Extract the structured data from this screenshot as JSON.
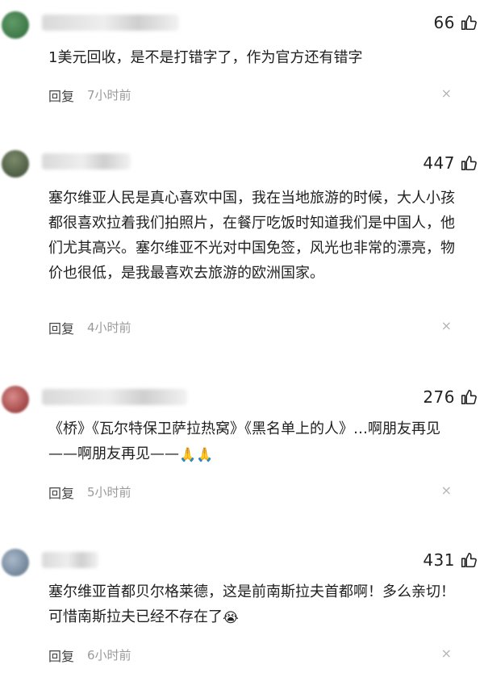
{
  "comments": [
    {
      "likes": "66",
      "text": "1美元回收，是不是打错字了，作为官方还有错字",
      "reply_label": "回复",
      "time": "7小时前",
      "close_glyph": "×",
      "avatar_color": "#3f7f4a"
    },
    {
      "likes": "447",
      "text": "塞尔维亚人民是真心喜欢中国，我在当地旅游的时候，大人小孩都很喜欢拉着我们拍照片，在餐厅吃饭时知道我们是中国人，他们尤其高兴。塞尔维亚不光对中国免签，风光也非常的漂亮，物价也很低，是我最喜欢去旅游的欧洲国家。",
      "reply_label": "回复",
      "time": "4小时前",
      "close_glyph": "×",
      "avatar_color": "#4f5a45"
    },
    {
      "likes": "276",
      "text": "《桥》《瓦尔特保卫萨拉热窝》《黑名单上的人》…啊朋友再见——啊朋友再见——",
      "emoji": "🙏🙏",
      "reply_label": "回复",
      "time": "5小时前",
      "close_glyph": "×",
      "avatar_color": "#b04a4a"
    },
    {
      "likes": "431",
      "text": "塞尔维亚首都贝尔格莱德，这是前南斯拉夫首都啊！多么亲切！可惜南斯拉夫已经不存在了",
      "emoji": "😭",
      "reply_label": "回复",
      "time": "6小时前",
      "close_glyph": "×",
      "avatar_color": "#6a7f96"
    }
  ],
  "icons": {
    "like": "thumbs-up-icon",
    "close": "close-icon"
  }
}
